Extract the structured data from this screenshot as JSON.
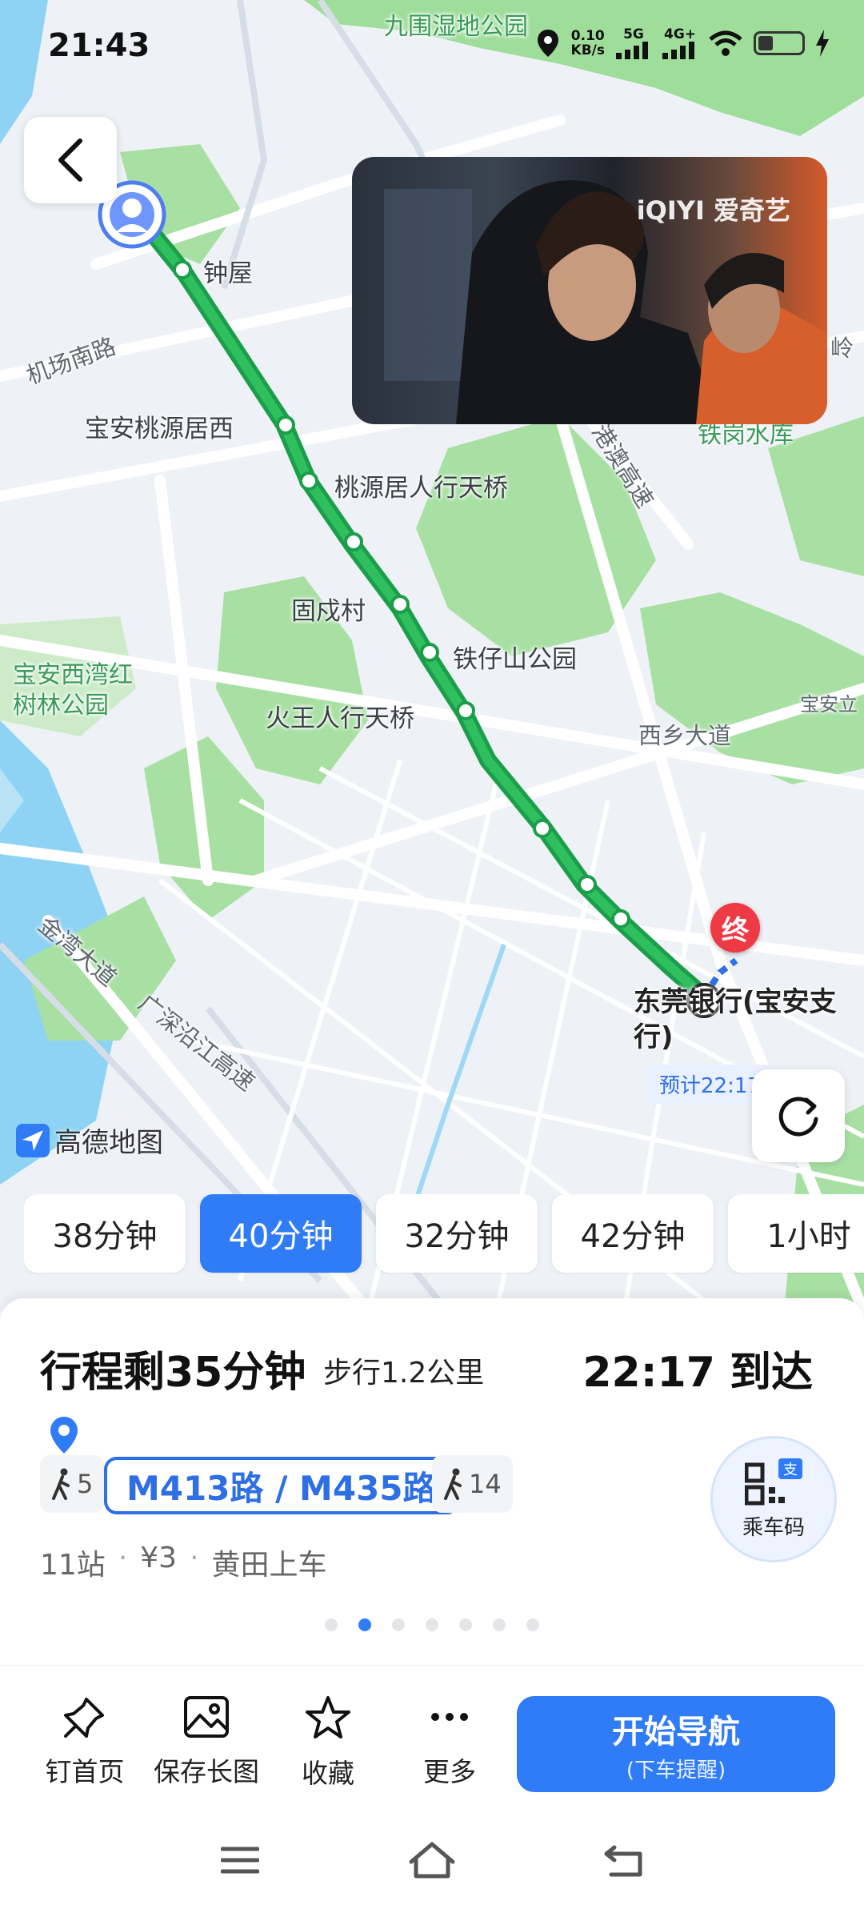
{
  "status_bar": {
    "time": "21:43",
    "net_speed": "0.10",
    "net_unit": "KB/s",
    "sim1": "5G",
    "sim2": "4G+"
  },
  "map": {
    "labels": {
      "park_top": "九围湿地公园",
      "zhongwu": "钟屋",
      "jichang_road": "机场南路",
      "taoyuan_west": "宝安桃源居西",
      "taoyuan_bridge": "桃源居人行天桥",
      "gushu": "固戍村",
      "tiezaishan": "铁仔山公园",
      "huowang": "火王人行天桥",
      "mangrove_1": "宝安西湾红",
      "mangrove_2": "树林公园",
      "xixiang": "西乡大道",
      "gangao": "港澳高速",
      "tiegang": "铁岗水库",
      "baoan_li": "宝安立",
      "ling": "岭",
      "jinwan": "金湾大道",
      "guangshen": "广深沿江高速",
      "dest_name": "东莞银行(宝安支行)",
      "dest_pin": "终",
      "eta": "预计22:17",
      "amap": "高德地图"
    },
    "video_logo": "iQIYI 爱奇艺",
    "route_color": "#1a9e4a"
  },
  "route_options": [
    {
      "label": "38分钟",
      "active": false
    },
    {
      "label": "40分钟",
      "active": true
    },
    {
      "label": "32分钟",
      "active": false
    },
    {
      "label": "42分钟",
      "active": false
    },
    {
      "label": "1小时",
      "active": false
    }
  ],
  "trip": {
    "title": "行程剩35分钟",
    "walk": "步行1.2公里",
    "arrival": "22:17 到达",
    "walk_before": "5",
    "bus": "M413路 / M435路",
    "walk_after": "14",
    "stops": "11站",
    "fare": "¥3",
    "boarding": "黄田上车",
    "ride_code": "乘车码",
    "pages": 7,
    "active_page": 1
  },
  "actions": {
    "pin_home": "钉首页",
    "save_image": "保存长图",
    "favorite": "收藏",
    "more": "更多",
    "start_nav": "开始导航",
    "start_nav_sub": "(下车提醒)"
  },
  "icons": [
    "back-arrow-icon",
    "location-icon",
    "refresh-icon",
    "walk-icon",
    "qr-code-icon",
    "pin-icon",
    "image-icon",
    "star-icon",
    "more-icon",
    "menu-icon",
    "home-icon",
    "back-icon"
  ]
}
